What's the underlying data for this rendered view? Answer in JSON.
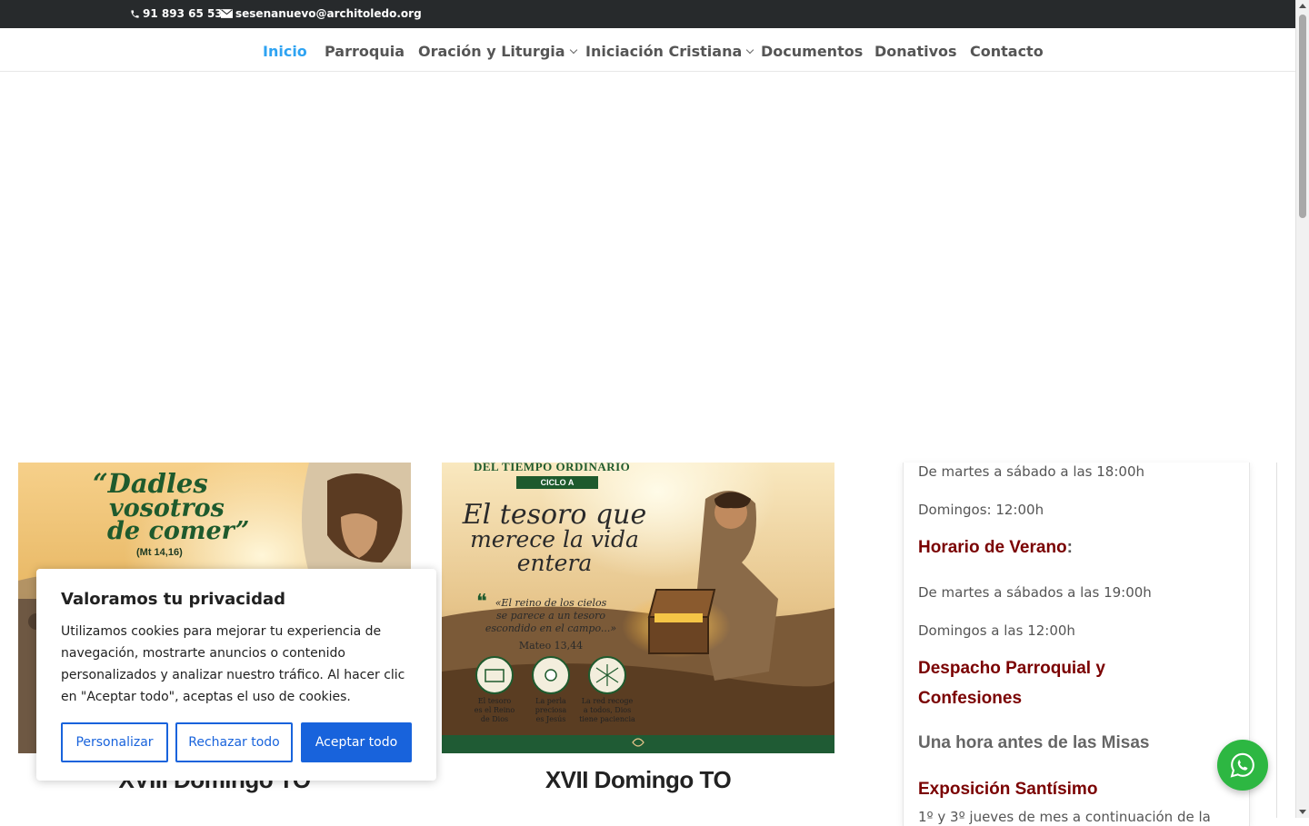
{
  "topbar": {
    "phone": "91 893 65 53",
    "email": "sesenanuevo@architoledo.org"
  },
  "nav": {
    "items": [
      {
        "label": "Inicio",
        "active": true
      },
      {
        "label": "Parroquia"
      },
      {
        "label": "Oración y Liturgia",
        "dropdown": true
      },
      {
        "label": "Iniciación Cristiana",
        "dropdown": true
      },
      {
        "label": "Documentos"
      },
      {
        "label": "Donativos"
      },
      {
        "label": "Contacto"
      }
    ]
  },
  "posts": [
    {
      "title": "XVIII Domingo TO",
      "image_text": {
        "quote": "“Dadles vosotros de comer”",
        "quote_line1": "“Dadles",
        "quote_line2": "vosotros",
        "quote_line3": "de comer”",
        "ref": "(Mt 14,16)"
      }
    },
    {
      "title": "XVII Domingo TO",
      "image_text": {
        "header": "DEL TIEMPO ORDINARIO",
        "cycle": "CICLO A",
        "headline1": "El tesoro que",
        "headline2": "merece la vida",
        "headline3": "entera",
        "quote1": "«El reino de los cielos",
        "quote2": "se parece a un tesoro",
        "quote3": "escondido en el campo...»",
        "ref": "Mateo 13,44",
        "icons": [
          {
            "l1": "El tesoro",
            "l2": "es el Reino",
            "l3": "de Dios"
          },
          {
            "l1": "La perla",
            "l2": "preciosa",
            "l3": "es Jesús"
          },
          {
            "l1": "La red recoge",
            "l2": "a todos, Dios",
            "l3": "tiene paciencia"
          }
        ]
      }
    }
  ],
  "sidebar": {
    "line1": "De martes a sábado a las 18:00h",
    "line2": "Domingos: 12:00h",
    "summer_heading": "Horario de Verano",
    "summer_colon": ":",
    "line3": "De martes a sábados a las 19:00h",
    "line4": "Domingos a las 12:00h",
    "office_heading1": "Despacho Parroquial y",
    "office_heading2": "Confesiones",
    "office_text": "Una hora antes de las Misas",
    "exposition_heading": "Exposición Santísimo",
    "exposition_text": "1º y 3º jueves de mes a continuación de la"
  },
  "cookie": {
    "title": "Valoramos tu privacidad",
    "text": "Utilizamos cookies para mejorar tu experiencia de navegación, mostrarte anuncios o contenido personalizados y analizar nuestro tráfico. Al hacer clic en \"Aceptar todo\", aceptas el uso de cookies.",
    "customize": "Personalizar",
    "reject": "Rechazar todo",
    "accept": "Aceptar todo"
  },
  "colors": {
    "topbar_bg": "#272a2c",
    "nav_active": "#2ea3f2",
    "heading_red": "#7a0000",
    "cookie_blue": "#1863dc",
    "whatsapp_green": "#2db742"
  }
}
